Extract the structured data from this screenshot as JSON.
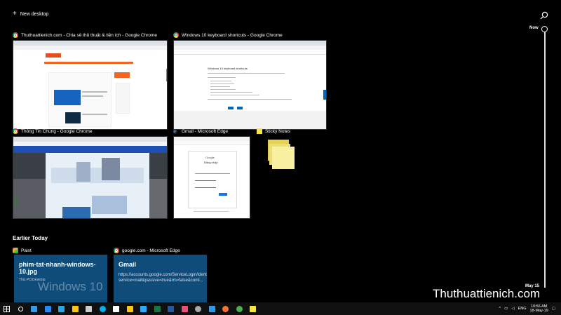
{
  "header": {
    "new_desktop_label": "New desktop",
    "search_icon": "search-icon"
  },
  "timeline": {
    "now_label": "Now",
    "date_label": "May 15"
  },
  "windows": [
    {
      "title": "Thuthuattienich.com - Chia sẻ thủ thuật & tiện ích - Google Chrome",
      "app": "chrome"
    },
    {
      "title": "Windows 10 keyboard shortcuts - Google Chrome",
      "app": "chrome"
    },
    {
      "title": "Thông Tin Chung - Google Chrome",
      "app": "chrome"
    },
    {
      "title": "Gmail - Microsoft Edge",
      "app": "edge"
    },
    {
      "title": "Sticky Notes",
      "app": "sticky-notes"
    }
  ],
  "thumb_text": {
    "win10_heading": "Windows 10 keyboard shortcuts",
    "gmail_heading": "Google",
    "gmail_sub": "Đăng nhập"
  },
  "earlier": {
    "section_title": "Earlier Today",
    "activities": [
      {
        "app_label": "Paint",
        "card_title": "phim-tat-nhanh-windows-10.jpg",
        "card_sub": "This PC\\Desktop",
        "card_watermark": "Windows 10",
        "card_color": "#0f4c7a"
      },
      {
        "app_label": "google.com - Microsoft Edge",
        "card_title": "Gmail",
        "card_url": "https://accounts.google.com/ServiceLogin/identifier?service=mail&passive=true&rm=false&conti...",
        "card_color": "#0f4c7a"
      }
    ]
  },
  "watermark": "Thuthuattienich.com",
  "taskbar": {
    "apps": [
      "start-icon",
      "search-icon",
      "edge-tab-icon",
      "check-icon",
      "telegram-icon",
      "file-explorer-icon",
      "store-icon",
      "skype-icon",
      "mail-icon",
      "folder-icon",
      "photoshop-icon",
      "excel-icon",
      "word-icon",
      "app-icon",
      "snipping-icon",
      "edge-icon",
      "firefox-icon",
      "chrome-icon",
      "sticky-notes-icon"
    ],
    "colors": [
      "#ffffff",
      "#ffffff",
      "#3a96dd",
      "#2d89ef",
      "#2aa3df",
      "#f5c518",
      "#cccccc",
      "#00aff0",
      "#ffffff",
      "#f5c518",
      "#31a8ff",
      "#1f7244",
      "#2b579a",
      "#e94e77",
      "#aaaaaa",
      "#3a96dd",
      "#ff7139",
      "#4caf50",
      "#f5e54a"
    ],
    "language": "ENG",
    "time": "10:56 AM",
    "date": "18-May-19"
  }
}
